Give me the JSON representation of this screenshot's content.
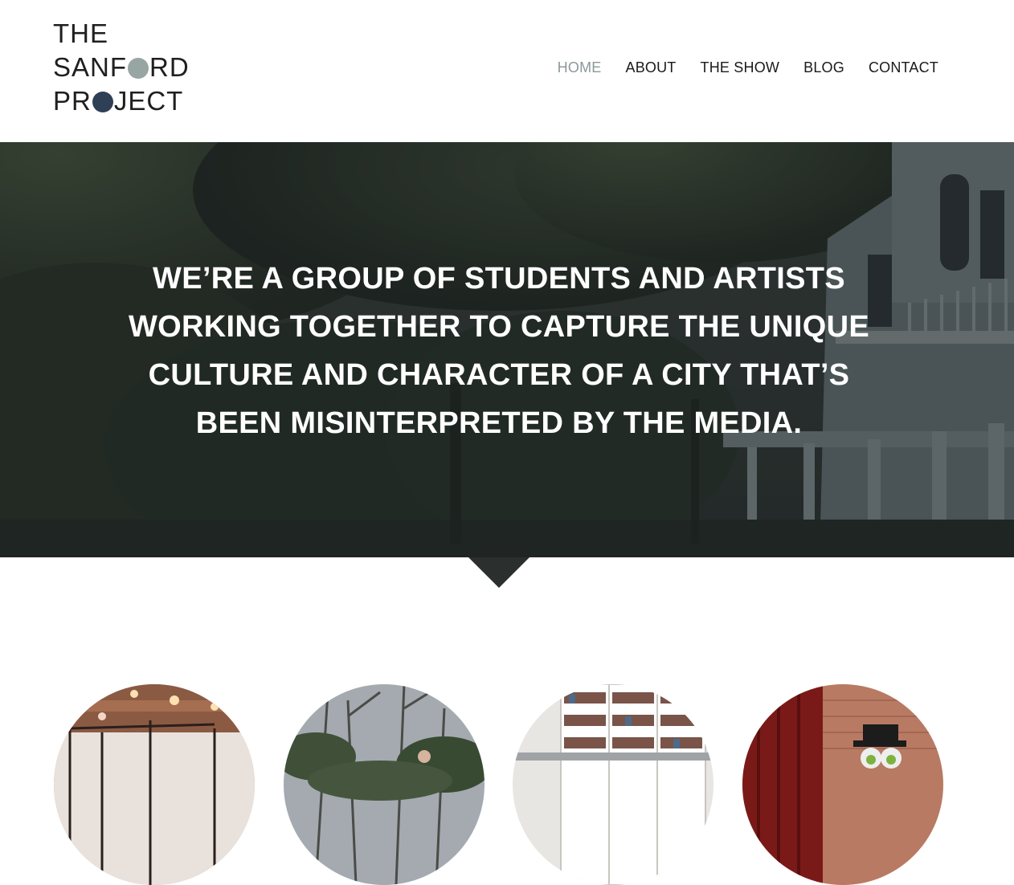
{
  "logo": {
    "line1": "THE",
    "line2_before": "SANF",
    "line2_after": "RD",
    "line3_before": "PR",
    "line3_after": "JECT",
    "circle_color_1": "#97a5a3",
    "circle_color_2": "#2f3f55"
  },
  "nav": {
    "items": [
      {
        "label": "HOME",
        "active": true
      },
      {
        "label": "ABOUT",
        "active": false
      },
      {
        "label": "THE SHOW",
        "active": false
      },
      {
        "label": "BLOG",
        "active": false
      },
      {
        "label": "CONTACT",
        "active": false
      }
    ],
    "active_color": "#8c9899",
    "color": "#1a1a1a"
  },
  "hero": {
    "lines": [
      "WE’RE A GROUP OF STUDENTS AND ARTISTS",
      "WORKING TOGETHER TO CAPTURE THE UNIQUE",
      "CULTURE AND CHARACTER OF A CITY THAT’S",
      "BEEN MISINTERPRETED BY THE MEDIA."
    ]
  },
  "features": [
    {
      "name": "photo-gallery-room"
    },
    {
      "name": "photo-forest-group"
    },
    {
      "name": "photo-bookstore-reading"
    },
    {
      "name": "photo-theater-stage"
    }
  ]
}
